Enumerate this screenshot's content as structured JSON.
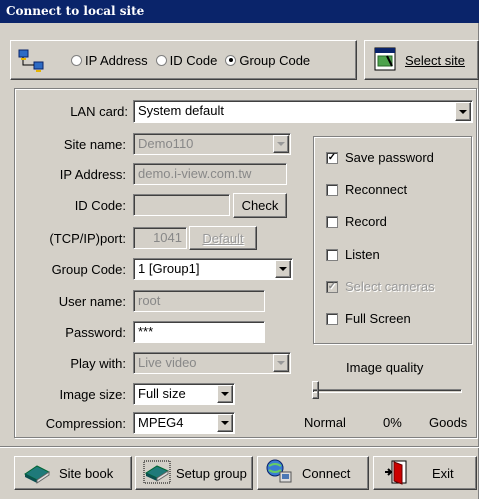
{
  "window": {
    "title": "Connect to local site"
  },
  "mode": {
    "options": [
      "IP Address",
      "ID Code",
      "Group Code"
    ],
    "selected": "Group Code",
    "select_site_label": "Select site"
  },
  "form": {
    "lan_card": {
      "label": "LAN card:",
      "value": "System default"
    },
    "site_name": {
      "label": "Site name:",
      "value": "Demo110"
    },
    "ip_address": {
      "label": "IP Address:",
      "value": "demo.i-view.com.tw"
    },
    "id_code": {
      "label": "ID Code:",
      "value": "",
      "check_label": "Check"
    },
    "port": {
      "label": "(TCP/IP)port:",
      "value": "1041",
      "default_label": "Default"
    },
    "group_code": {
      "label": "Group Code:",
      "value": "1 [Group1]"
    },
    "user_name": {
      "label": "User name:",
      "value": "root"
    },
    "password": {
      "label": "Password:",
      "value": "***"
    },
    "play_with": {
      "label": "Play with:",
      "value": "Live video"
    },
    "image_size": {
      "label": "Image size:",
      "value": "Full size"
    },
    "compression": {
      "label": "Compression:",
      "value": "MPEG4"
    }
  },
  "options": {
    "save_password": {
      "label": "Save password",
      "checked": true
    },
    "reconnect": {
      "label": "Reconnect",
      "checked": false
    },
    "record": {
      "label": "Record",
      "checked": false
    },
    "listen": {
      "label": "Listen",
      "checked": false
    },
    "select_cameras": {
      "label": "Select cameras",
      "checked": true
    },
    "full_screen": {
      "label": "Full Screen",
      "checked": false
    }
  },
  "quality": {
    "title": "Image quality",
    "min_label": "Normal",
    "value_label": "0%",
    "max_label": "Goods",
    "value": 0
  },
  "toolbar": {
    "site_book": "Site book",
    "setup_group": "Setup group",
    "connect": "Connect",
    "exit": "Exit"
  }
}
